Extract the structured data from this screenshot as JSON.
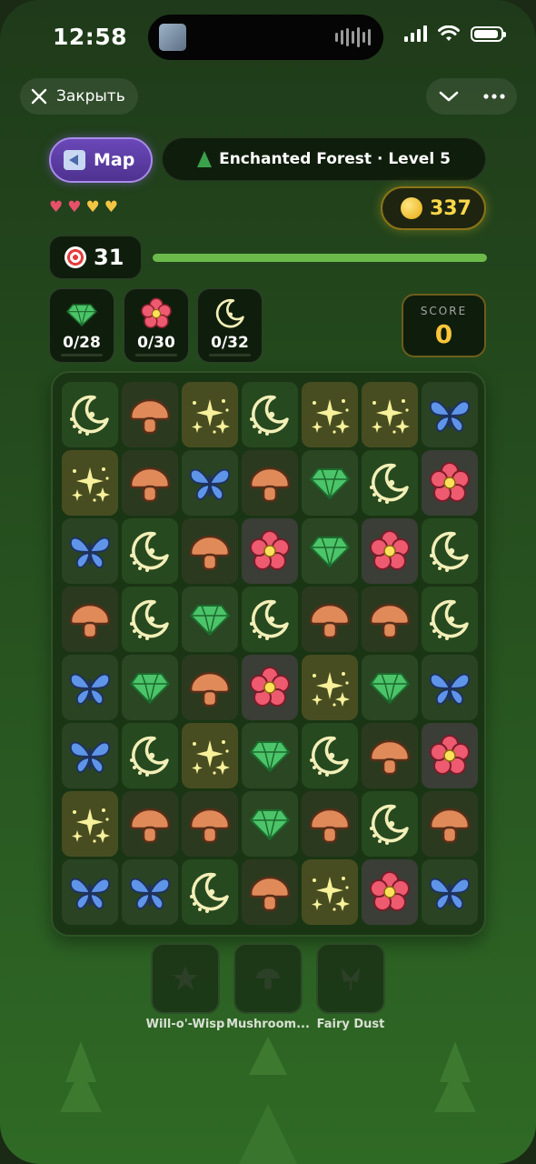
{
  "status": {
    "time": "12:58"
  },
  "topbar": {
    "close_label": "Закрыть"
  },
  "header": {
    "map_label": "Map",
    "level_title": "Enchanted Forest · Level 5"
  },
  "lives": {
    "total": 4,
    "colors": [
      "#e8506a",
      "#e8506a",
      "#f2c544",
      "#f2c544"
    ]
  },
  "coins": "337",
  "moves": "31",
  "move_progress": 1.0,
  "goals": [
    {
      "icon": "gem-icon",
      "text": "0/28"
    },
    {
      "icon": "flower-icon",
      "text": "0/30"
    },
    {
      "icon": "moon-icon",
      "text": "0/32"
    }
  ],
  "score": {
    "label": "SCORE",
    "value": "0"
  },
  "board": {
    "rows": [
      [
        "moon",
        "mush",
        "spark",
        "moon",
        "spark",
        "spark",
        "butter"
      ],
      [
        "spark",
        "mush",
        "butter",
        "mush",
        "gem",
        "moon",
        "flower"
      ],
      [
        "butter",
        "moon",
        "mush",
        "flower",
        "gem",
        "flower",
        "moon"
      ],
      [
        "mush",
        "moon",
        "gem",
        "moon",
        "mush",
        "mush",
        "moon"
      ],
      [
        "butter",
        "gem",
        "mush",
        "flower",
        "spark",
        "gem",
        "butter"
      ],
      [
        "butter",
        "moon",
        "spark",
        "gem",
        "moon",
        "mush",
        "flower"
      ],
      [
        "spark",
        "mush",
        "mush",
        "gem",
        "mush",
        "moon",
        "mush"
      ],
      [
        "butter",
        "butter",
        "moon",
        "mush",
        "spark",
        "flower",
        "butter"
      ]
    ]
  },
  "powerups": [
    {
      "label": "Will-o'-Wisp",
      "icon": "star-icon"
    },
    {
      "label": "Mushroom...",
      "icon": "mushroom-icon"
    },
    {
      "label": "Fairy Dust",
      "icon": "fairy-icon"
    }
  ],
  "colors": {
    "accent": "#6cba4a",
    "coin": "#ffd84a",
    "score": "#ffc53a",
    "map_btn": "#5a3ca6"
  }
}
